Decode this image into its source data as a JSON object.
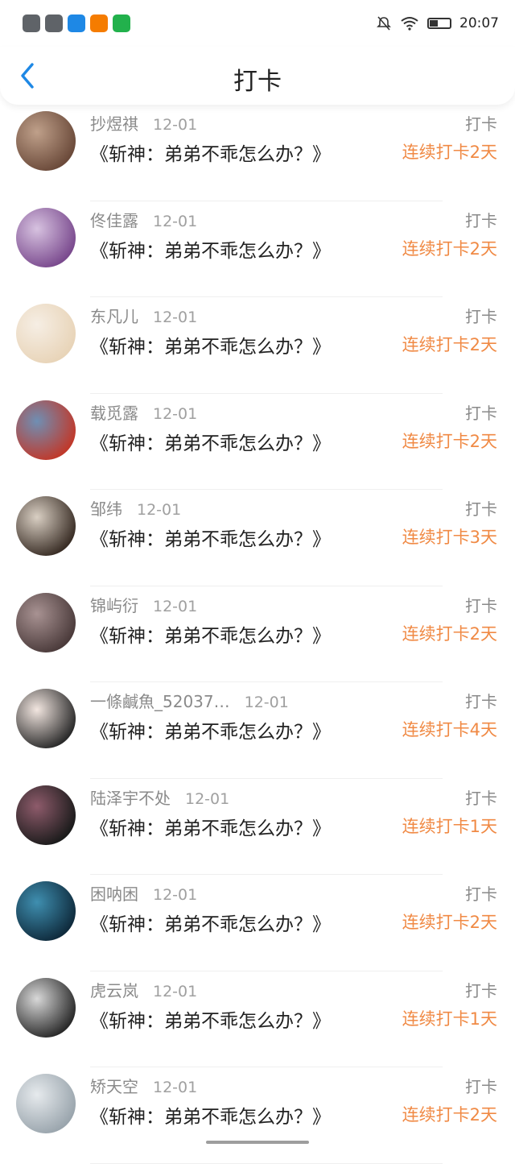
{
  "status_bar": {
    "time": "20:07",
    "icons": [
      "game-controller-icon",
      "game-controller-icon",
      "shield-icon",
      "orange-app-icon",
      "camera-icon"
    ]
  },
  "header": {
    "title": "打卡",
    "back_icon": "chevron-left-icon"
  },
  "colors": {
    "accent": "#f08a45",
    "back": "#1e88e5",
    "muted": "#8a8a8a"
  },
  "entries": [
    {
      "name": "抄煜祺",
      "date": "12-01",
      "book": "《斩神：弟弟不乖怎么办？》",
      "action": "打卡",
      "streak": "连续打卡2天",
      "avatar": [
        "#6b4a3a",
        "#bfa08a"
      ]
    },
    {
      "name": "佟佳露",
      "date": "12-01",
      "book": "《斩神：弟弟不乖怎么办？》",
      "action": "打卡",
      "streak": "连续打卡2天",
      "avatar": [
        "#7a4a8e",
        "#d7c2e0"
      ]
    },
    {
      "name": "东凡儿",
      "date": "12-01",
      "book": "《斩神：弟弟不乖怎么办？》",
      "action": "打卡",
      "streak": "连续打卡2天",
      "avatar": [
        "#e8d4b8",
        "#f6eee4"
      ]
    },
    {
      "name": "载觅露",
      "date": "12-01",
      "book": "《斩神：弟弟不乖怎么办？》",
      "action": "打卡",
      "streak": "连续打卡2天",
      "avatar": [
        "#c0392b",
        "#6f8fb4"
      ]
    },
    {
      "name": "邹纬",
      "date": "12-01",
      "book": "《斩神：弟弟不乖怎么办？》",
      "action": "打卡",
      "streak": "连续打卡3天",
      "avatar": [
        "#3a2e26",
        "#d9cfc3"
      ]
    },
    {
      "name": "锦屿衍",
      "date": "12-01",
      "book": "《斩神：弟弟不乖怎么办？》",
      "action": "打卡",
      "streak": "连续打卡2天",
      "avatar": [
        "#4b3b3b",
        "#a89292"
      ]
    },
    {
      "name": "一條鹹魚_52037…",
      "date": "12-01",
      "book": "《斩神：弟弟不乖怎么办？》",
      "action": "打卡",
      "streak": "连续打卡4天",
      "avatar": [
        "#2b2b2b",
        "#f2e6e0"
      ]
    },
    {
      "name": "陆泽宇不处",
      "date": "12-01",
      "book": "《斩神：弟弟不乖怎么办？》",
      "action": "打卡",
      "streak": "连续打卡1天",
      "avatar": [
        "#1b1b1b",
        "#8e5b6b"
      ]
    },
    {
      "name": "困呐困",
      "date": "12-01",
      "book": "《斩神：弟弟不乖怎么办？》",
      "action": "打卡",
      "streak": "连续打卡2天",
      "avatar": [
        "#0f2b3d",
        "#3f8fb0"
      ]
    },
    {
      "name": "虎云岚",
      "date": "12-01",
      "book": "《斩神：弟弟不乖怎么办？》",
      "action": "打卡",
      "streak": "连续打卡1天",
      "avatar": [
        "#2a2a2a",
        "#d8d8d8"
      ]
    },
    {
      "name": "矫天空",
      "date": "12-01",
      "book": "《斩神：弟弟不乖怎么办？》",
      "action": "打卡",
      "streak": "连续打卡2天",
      "avatar": [
        "#9aa5ad",
        "#e6eaed"
      ]
    }
  ]
}
